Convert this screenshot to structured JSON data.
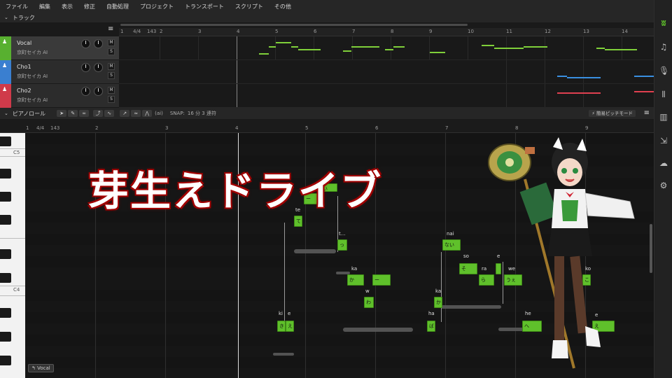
{
  "menu": [
    "ファイル",
    "編集",
    "表示",
    "修正",
    "自動処理",
    "プロジェクト",
    "トランスポート",
    "スクリプト",
    "その他"
  ],
  "tracks_section": {
    "title": "トラック"
  },
  "track_ruler": {
    "marks": [
      "1",
      "4/4",
      "143",
      "2",
      "3",
      "4",
      "5",
      "6",
      "7",
      "8",
      "9",
      "10",
      "11",
      "12",
      "13",
      "14"
    ]
  },
  "tracks": [
    {
      "name": "Vocal",
      "voice": "京町セイカ AI",
      "color": "#58b030",
      "note_color": "#7fcf3a",
      "m": "M",
      "s": "S"
    },
    {
      "name": "Cho1",
      "voice": "京町セイカ AI",
      "color": "#3a7fd0",
      "note_color": "#3a8fe0",
      "m": "M",
      "s": "S"
    },
    {
      "name": "Cho2",
      "voice": "京町セイカ AI",
      "color": "#d03a4a",
      "note_color": "#e04050",
      "m": "M",
      "s": "S"
    }
  ],
  "piano_roll": {
    "title": "ピアノロール",
    "snap": "SNAP:",
    "snap_value": "16 分 3 連符",
    "pitch_mode": "⚡ 簡易ピッチモード",
    "ai_label": "(ai)",
    "ruler_marks": [
      "1",
      "4/4",
      "143",
      "2",
      "3",
      "4",
      "5",
      "6",
      "7",
      "8",
      "9"
    ],
    "key_labels": {
      "c5": "C5",
      "c4": "C4"
    },
    "track_tag": "↰ Vocal"
  },
  "overlay_title": "芽生えドライブ",
  "notes": [
    {
      "lyric": "き",
      "phoneme": "ki"
    },
    {
      "lyric": "え",
      "phoneme": "e"
    },
    {
      "lyric": "て",
      "phoneme": "te"
    },
    {
      "lyric": "ー",
      "phoneme": ""
    },
    {
      "lyric": "い",
      "phoneme": "i"
    },
    {
      "lyric": "っ",
      "phoneme": "t..."
    },
    {
      "lyric": "か",
      "phoneme": "ka"
    },
    {
      "lyric": "ー",
      "phoneme": ""
    },
    {
      "lyric": "わ",
      "phoneme": "w"
    },
    {
      "lyric": "ば",
      "phoneme": "ha"
    },
    {
      "lyric": "か",
      "phoneme": "ka"
    },
    {
      "lyric": "ない",
      "phoneme": "nai"
    },
    {
      "lyric": "そ",
      "phoneme": "so"
    },
    {
      "lyric": "ら",
      "phoneme": "ra"
    },
    {
      "lyric": "",
      "phoneme": "e"
    },
    {
      "lyric": "うぇ",
      "phoneme": "we"
    },
    {
      "lyric": "へ",
      "phoneme": "he"
    },
    {
      "lyric": "こ",
      "phoneme": "ko"
    },
    {
      "lyric": "え",
      "phoneme": "e"
    }
  ],
  "sidebar_icons": [
    "logo-icon",
    "music-note-icon",
    "microphone-icon",
    "library-icon",
    "piano-icon",
    "export-icon",
    "cloud-icon",
    "settings-icon"
  ]
}
